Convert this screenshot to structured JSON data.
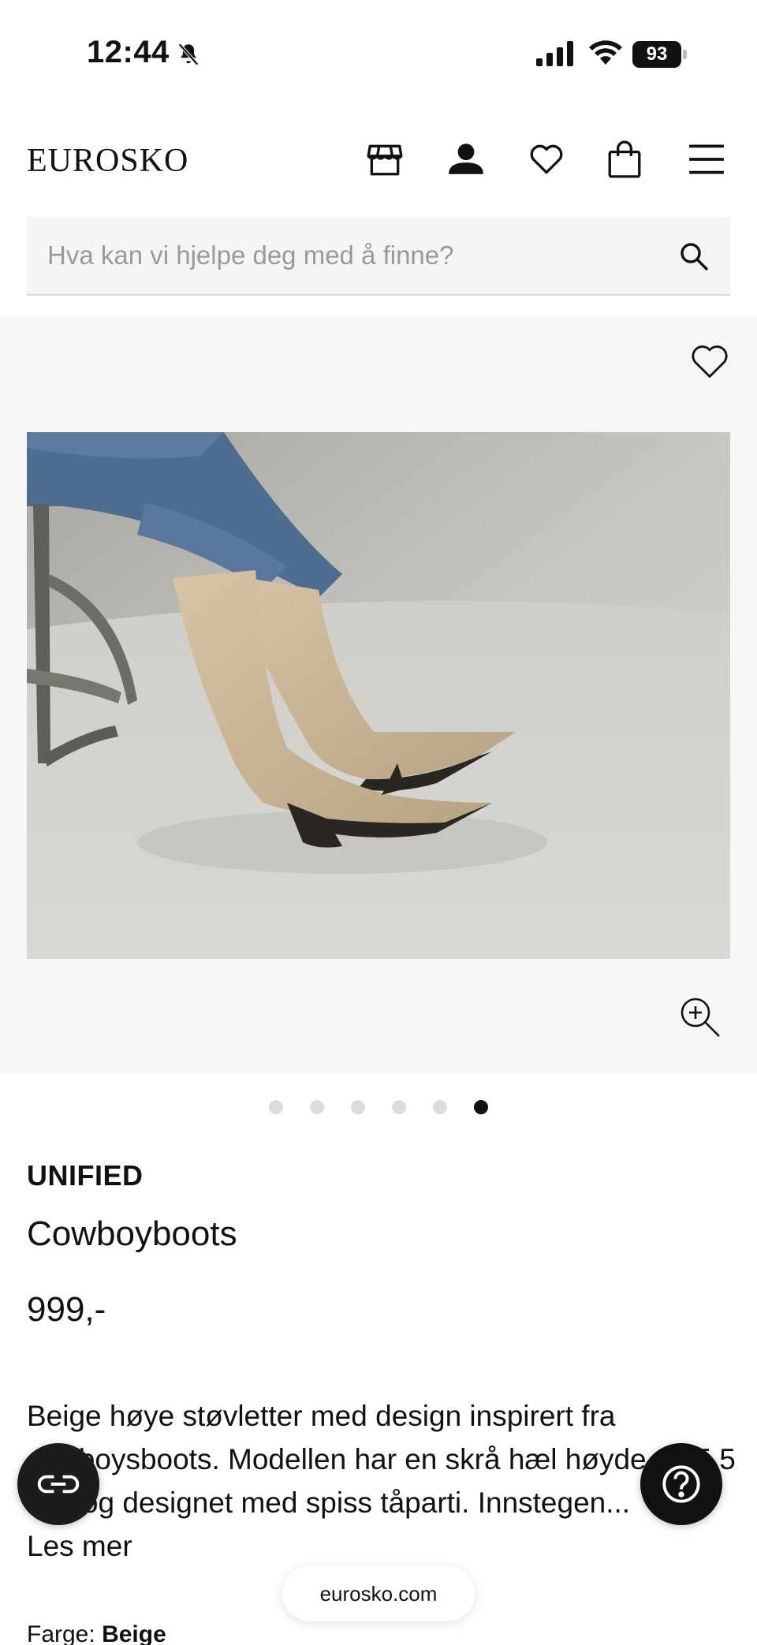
{
  "status": {
    "time": "12:44",
    "battery": "93"
  },
  "header": {
    "logo": "EUROSKO",
    "icons": [
      "store-icon",
      "account-icon",
      "heart-icon",
      "bag-icon",
      "menu-icon"
    ]
  },
  "search": {
    "placeholder": "Hva kan vi hjelpe deg med å finne?",
    "value": ""
  },
  "gallery": {
    "image_count": 6,
    "active_index": 5
  },
  "product": {
    "brand": "UNIFIED",
    "name": "Cowboyboots",
    "price": "999,-",
    "description": "Beige høye støvletter med design inspirert fra cowboysboots. Modellen har en skrå hæl høyde på 5,5 cm, og designet med spiss tåparti. Innstegen...",
    "read_more": "Les mer",
    "color_label": "Farge:",
    "color_value": "Beige"
  },
  "browser": {
    "url": "eurosko.com"
  },
  "colors": {
    "background": "#ffffff",
    "gallery_bg": "#f6f6f4",
    "text": "#111111",
    "search_bg": "#f5f5f5"
  }
}
